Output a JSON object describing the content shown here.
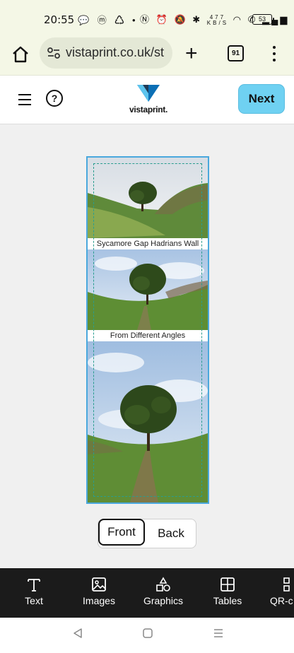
{
  "status_bar": {
    "time": "20:55",
    "network_speed_value": "477",
    "network_speed_unit": "KB/S",
    "battery": "53"
  },
  "browser": {
    "url": "vistaprint.co.uk/st",
    "tab_count": "91"
  },
  "site_header": {
    "logo_text": "vistaprint.",
    "next_label": "Next",
    "help_symbol": "?"
  },
  "design": {
    "caption_1": "Sycamore Gap Hadrians Wall",
    "caption_2": "From Different Angles"
  },
  "side_toggle": {
    "front_label": "Front",
    "back_label": "Back"
  },
  "toolbar": {
    "items": [
      {
        "label": "Text",
        "icon": "text-icon"
      },
      {
        "label": "Images",
        "icon": "image-icon"
      },
      {
        "label": "Graphics",
        "icon": "shapes-icon"
      },
      {
        "label": "Tables",
        "icon": "table-icon"
      },
      {
        "label": "QR-c",
        "icon": "qr-icon"
      }
    ]
  },
  "colors": {
    "accent": "#6fd1f2",
    "toolbar_bg": "#1b1b1b",
    "browser_bg": "#f4f7e6",
    "selection_border": "#4aa8dd",
    "safe_area": "#2a9d8f"
  }
}
